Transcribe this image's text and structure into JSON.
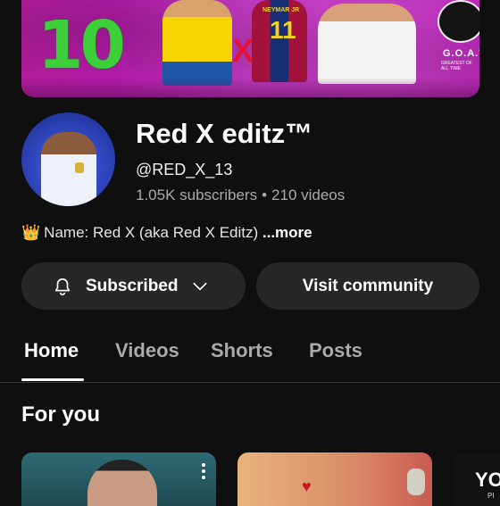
{
  "channel": {
    "name": "Red X editz™",
    "handle": "@RED_X_13",
    "subscribers": "1.05K subscribers",
    "videos": "210 videos",
    "stats_separator": "•",
    "description": "Name: Red X (aka Red X Editz)",
    "description_more": "...more"
  },
  "banner": {
    "jersey_number": "10",
    "player2_name": "NEYMAR JR",
    "player2_number": "11",
    "goat_text": "G.O.A.T",
    "goat_subtext": "GREATEST OF ALL TIME"
  },
  "actions": {
    "subscribed_label": "Subscribed",
    "visit_label": "Visit community"
  },
  "tabs": [
    {
      "label": "Home",
      "active": true
    },
    {
      "label": "Videos",
      "active": false
    },
    {
      "label": "Shorts",
      "active": false
    },
    {
      "label": "Posts",
      "active": false
    }
  ],
  "section": {
    "title": "For you"
  },
  "cards": [
    {
      "icon": "more-vert-icon"
    },
    {
      "icon": "heart-icon"
    },
    {
      "text": "YO",
      "subtext": "PI"
    }
  ],
  "colors": {
    "background": "#0f0f0f",
    "button": "#272727",
    "muted_text": "#aaaaaa"
  }
}
